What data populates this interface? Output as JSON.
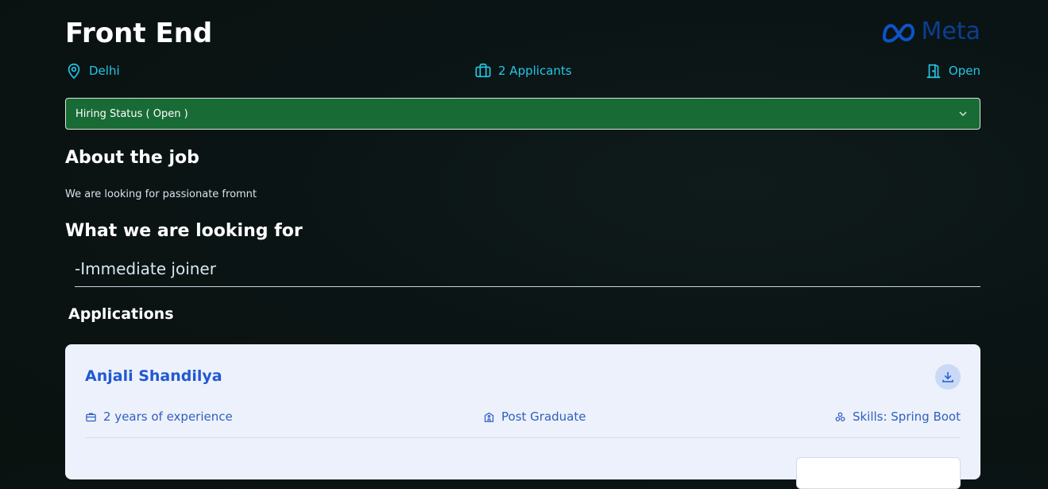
{
  "job": {
    "title": "Front End",
    "company_logo_text": "Meta",
    "location": "Delhi",
    "applicants": "2 Applicants",
    "status": "Open"
  },
  "hiring_status": {
    "selected": "Hiring Status ( Open )"
  },
  "about": {
    "heading": "About the job",
    "text": "We are looking for passionate fromnt"
  },
  "requirements": {
    "heading": "What we are looking for",
    "value": "-Immediate joiner"
  },
  "applications": {
    "heading": "Applications",
    "items": [
      {
        "name": "Anjali Shandilya",
        "experience": "2 years of experience",
        "education": "Post Graduate",
        "skills": "Skills: Spring Boot"
      }
    ]
  },
  "colors": {
    "accent_cyan": "#22c7e8",
    "status_green": "#196b36",
    "meta_blue": "#0b55c7",
    "card_bg": "#edf1fb",
    "card_text": "#2059d1"
  },
  "icons": {
    "location": "map-pin-icon",
    "applicants": "briefcase-icon",
    "status": "door-open-icon",
    "dropdown": "chevron-down-icon",
    "download": "download-icon",
    "experience": "briefcase-icon",
    "education": "school-icon",
    "skills": "skills-icon"
  }
}
